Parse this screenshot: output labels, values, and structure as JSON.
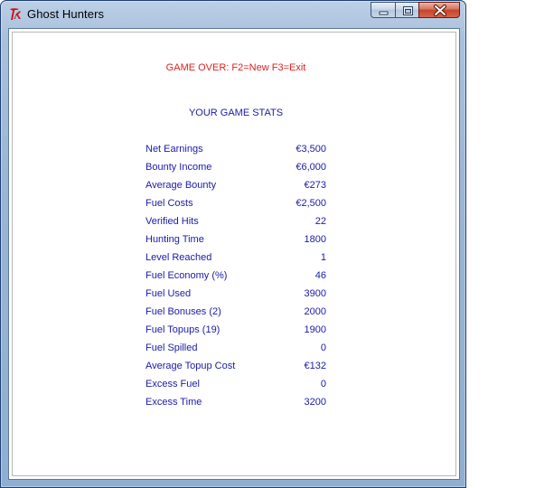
{
  "window": {
    "title": "Ghost Hunters",
    "icon": "tk-feather-icon"
  },
  "message": "GAME OVER: F2=New F3=Exit",
  "stats_heading": "YOUR GAME STATS",
  "stats": [
    {
      "label": "Net Earnings",
      "value": "€3,500"
    },
    {
      "label": "Bounty Income",
      "value": "€6,000"
    },
    {
      "label": "Average Bounty",
      "value": "€273"
    },
    {
      "label": "Fuel Costs",
      "value": "€2,500"
    },
    {
      "label": "Verified Hits",
      "value": "22"
    },
    {
      "label": "Hunting Time",
      "value": "1800"
    },
    {
      "label": "Level Reached",
      "value": "1"
    },
    {
      "label": "Fuel Economy (%)",
      "value": "46"
    },
    {
      "label": "Fuel Used",
      "value": "3900"
    },
    {
      "label": "Fuel Bonuses (2)",
      "value": "2000"
    },
    {
      "label": "Fuel Topups (19)",
      "value": "1900"
    },
    {
      "label": "Fuel Spilled",
      "value": "0"
    },
    {
      "label": "Average Topup Cost",
      "value": "€132"
    },
    {
      "label": "Excess Fuel",
      "value": "0"
    },
    {
      "label": "Excess Time",
      "value": "3200"
    }
  ],
  "colors": {
    "message": "#e02020",
    "stats_text": "#1a1aa8",
    "background": "#ffffff"
  }
}
